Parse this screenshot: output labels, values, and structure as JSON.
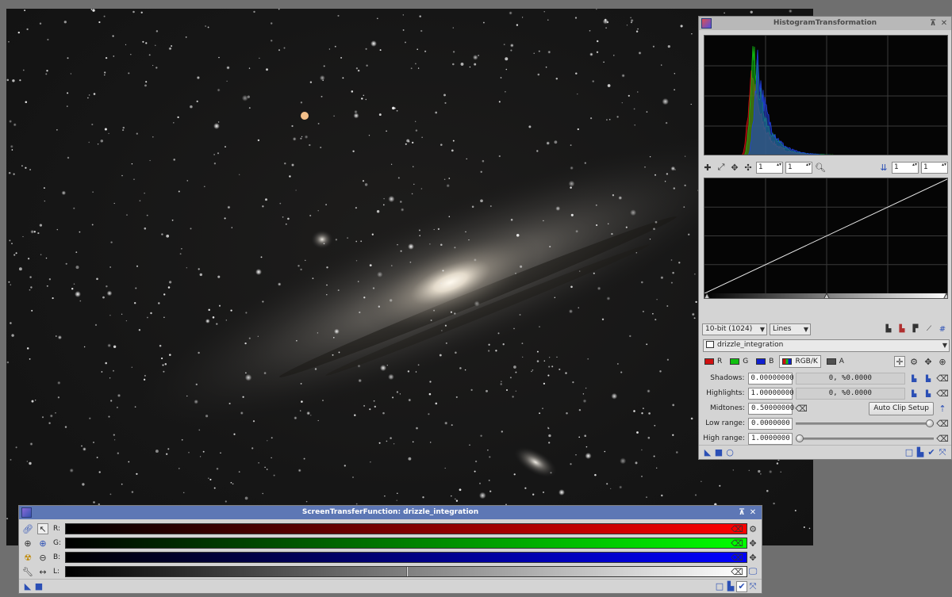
{
  "image": {
    "name": "drizzle_integration"
  },
  "histogram": {
    "title": "HistogramTransformation",
    "toolbar": {
      "zoom_x": "1",
      "zoom_y": "1",
      "channel_zoom_x": "1",
      "channel_zoom_y": "1"
    },
    "resolution": "10-bit (1024)",
    "graph_style": "Lines",
    "view_name": "drizzle_integration",
    "channels": [
      {
        "label": "R",
        "color": "#d01010"
      },
      {
        "label": "G",
        "color": "#10c010"
      },
      {
        "label": "B",
        "color": "#1020d0"
      },
      {
        "label": "RGB/K",
        "color": "#606060",
        "selected": true
      },
      {
        "label": "A",
        "color": "#505050"
      }
    ],
    "shadows": {
      "label": "Shadows:",
      "value": "0.00000000",
      "clip": "0, %0.0000"
    },
    "highlights": {
      "label": "Highlights:",
      "value": "1.00000000",
      "clip": "0, %0.0000"
    },
    "midtones": {
      "label": "Midtones:",
      "value": "0.50000000"
    },
    "auto_clip_label": "Auto Clip Setup",
    "low_range": {
      "label": "Low range:",
      "value": "0.0000000"
    },
    "high_range": {
      "label": "High range:",
      "value": "1.0000000"
    },
    "histogram_peak_position": 0.2,
    "midtones_level": 0.5,
    "low_range_level": 1.0,
    "high_range_level": 0.0
  },
  "stf": {
    "title": "ScreenTransferFunction: drizzle_integration",
    "channels": [
      {
        "label": "R:",
        "color": "#ff0000"
      },
      {
        "label": "G:",
        "color": "#00ff00"
      },
      {
        "label": "B:",
        "color": "#0000ff"
      },
      {
        "label": "L:",
        "color": "#ffffff"
      }
    ],
    "midtone_marker_level": 0.5
  },
  "colors": {
    "active_title": "#5d77b5",
    "inactive_title": "#b8b8b8",
    "panel_bg": "#d4d4d4",
    "desktop": "#6f6f6f"
  }
}
